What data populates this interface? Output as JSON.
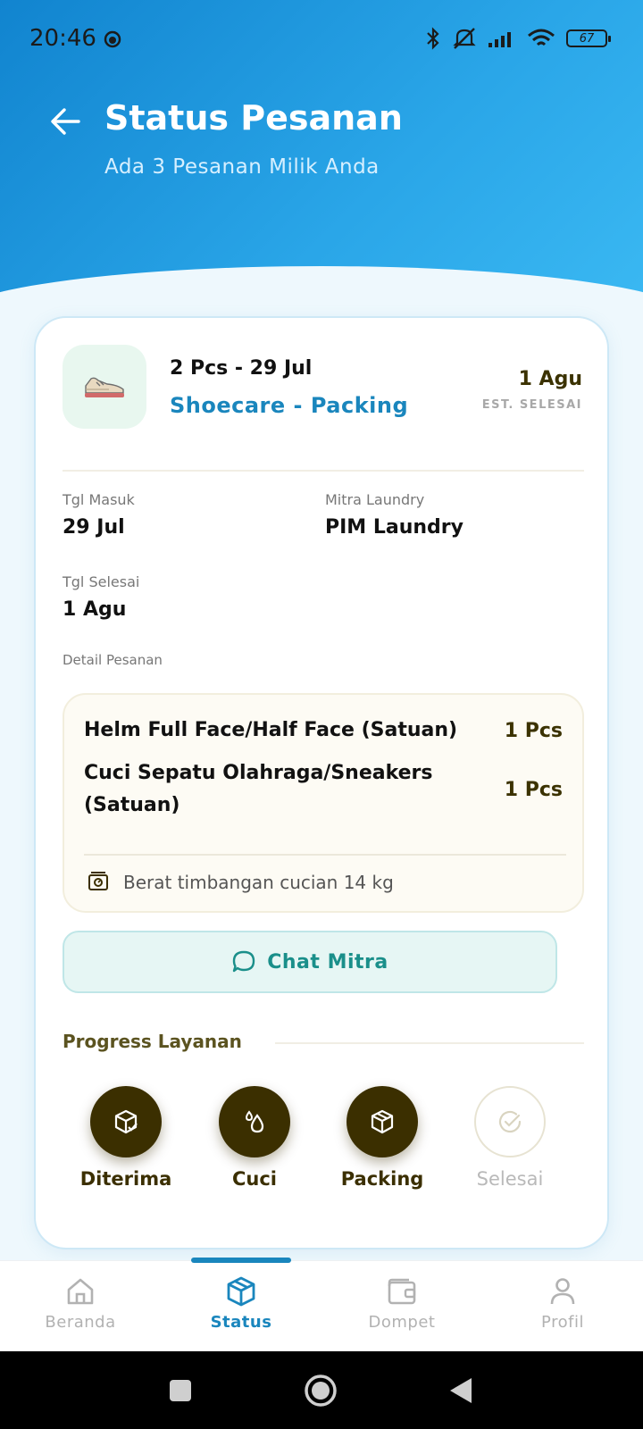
{
  "status_bar": {
    "time": "20:46",
    "battery": "67"
  },
  "header": {
    "title": "Status Pesanan",
    "subtitle": "Ada 3 Pesanan Milik Anda"
  },
  "order": {
    "summary": "2 Pcs - 29 Jul",
    "service": "Shoecare - Packing",
    "est_date": "1 Agu",
    "est_label": "EST. SELESAI",
    "fields": {
      "tgl_masuk_label": "Tgl Masuk",
      "tgl_masuk_value": "29 Jul",
      "mitra_label": "Mitra Laundry",
      "mitra_value": "PIM Laundry",
      "tgl_selesai_label": "Tgl Selesai",
      "tgl_selesai_value": "1 Agu",
      "detail_label": "Detail Pesanan"
    },
    "items": [
      {
        "name": "Helm Full Face/Half Face (Satuan)",
        "qty": "1 Pcs"
      },
      {
        "name": "Cuci Sepatu Olahraga/Sneakers (Satuan)",
        "qty": "1 Pcs"
      }
    ],
    "weight_text": "Berat timbangan cucian 14 kg",
    "chat_label": "Chat Mitra"
  },
  "progress": {
    "title": "Progress Layanan",
    "steps": [
      {
        "label": "Diterima",
        "done": true,
        "icon": "box-check-icon"
      },
      {
        "label": "Cuci",
        "done": true,
        "icon": "water-drops-icon"
      },
      {
        "label": "Packing",
        "done": true,
        "icon": "package-icon"
      },
      {
        "label": "Selesai",
        "done": false,
        "icon": "check-circle-icon"
      }
    ]
  },
  "nav": {
    "items": [
      {
        "label": "Beranda",
        "icon": "home-icon",
        "active": false
      },
      {
        "label": "Status",
        "icon": "box-icon",
        "active": true
      },
      {
        "label": "Dompet",
        "icon": "wallet-icon",
        "active": false
      },
      {
        "label": "Profil",
        "icon": "user-icon",
        "active": false
      }
    ]
  },
  "colors": {
    "accent": "#1a86bd",
    "brown": "#3b2f00",
    "teal": "#1a8f8a"
  }
}
